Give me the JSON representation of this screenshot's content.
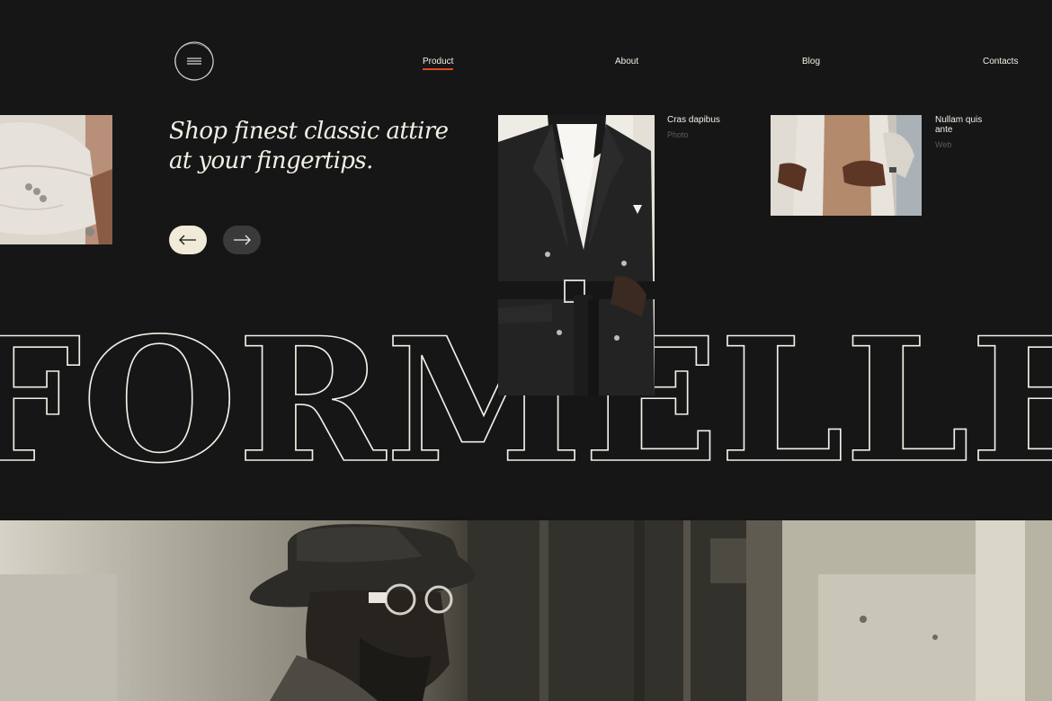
{
  "nav": {
    "items": [
      {
        "label": "Product",
        "active": true
      },
      {
        "label": "About",
        "active": false
      },
      {
        "label": "Blog",
        "active": false
      },
      {
        "label": "Contacts",
        "active": false
      }
    ]
  },
  "hero": {
    "tagline_line1": "Shop finest classic attire",
    "tagline_line2": "at your fingertips."
  },
  "brand": {
    "name": "FORMELLE"
  },
  "cards": [
    {
      "title": "Cras dapibus",
      "category": "Photo"
    },
    {
      "title_line1": "Nullam quis",
      "title_line2": "ante",
      "category": "Web"
    }
  ],
  "icons": {
    "menu": "hamburger-icon",
    "prev": "arrow-left-icon",
    "next": "arrow-right-icon"
  },
  "colors": {
    "background": "#161616",
    "text": "#f2efe6",
    "accent": "#e2461d",
    "prev_button": "#efebd8",
    "next_button": "#3a3a3a"
  }
}
